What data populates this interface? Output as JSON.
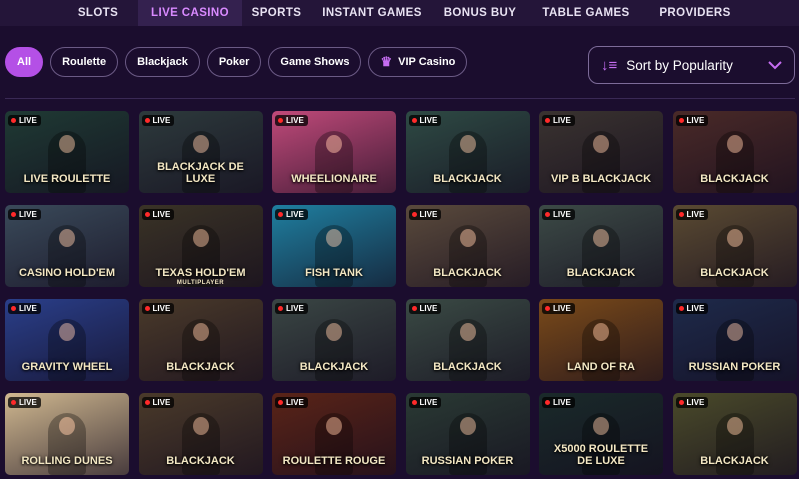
{
  "nav": {
    "items": [
      {
        "label": "SLOTS",
        "active": false
      },
      {
        "label": "LIVE CASINO",
        "active": true
      },
      {
        "label": "SPORTS",
        "active": false
      },
      {
        "label": "INSTANT GAMES",
        "active": false
      },
      {
        "label": "BONUS BUY",
        "active": false
      },
      {
        "label": "TABLE GAMES",
        "active": false
      },
      {
        "label": "PROVIDERS",
        "active": false
      }
    ]
  },
  "filters": {
    "chips": [
      {
        "label": "All",
        "active": true
      },
      {
        "label": "Roulette",
        "active": false
      },
      {
        "label": "Blackjack",
        "active": false
      },
      {
        "label": "Poker",
        "active": false
      },
      {
        "label": "Game Shows",
        "active": false
      },
      {
        "label": "VIP Casino",
        "active": false,
        "icon": "crown-icon"
      }
    ]
  },
  "sort": {
    "label": "Sort by Popularity",
    "icon": "sort-icon",
    "chevron": "chevron-down-icon"
  },
  "live_label": "LIVE",
  "colors": {
    "accent": "#b450e6",
    "background": "#1b0d2e",
    "nav": "#241539",
    "live_dot": "#ff2a2a"
  },
  "tiles": [
    {
      "title": "LIVE ROULETTE",
      "sub": "",
      "bg": "#1f3a34"
    },
    {
      "title": "BLACKJACK DE LUXE",
      "sub": "",
      "bg": "#2d3a3c"
    },
    {
      "title": "WHEELIONAIRE",
      "sub": "",
      "bg": "#c04a7a"
    },
    {
      "title": "BLACKJACK",
      "sub": "",
      "bg": "#2e4a44"
    },
    {
      "title": "VIP B BLACKJACK",
      "sub": "",
      "bg": "#3a3330"
    },
    {
      "title": "BLACKJACK",
      "sub": "",
      "bg": "#4a2a28"
    },
    {
      "title": "CASINO HOLD'EM",
      "sub": "",
      "bg": "#3a4a5a"
    },
    {
      "title": "TEXAS HOLD'EM",
      "sub": "MULTIPLAYER",
      "bg": "#3a3326"
    },
    {
      "title": "FISH TANK",
      "sub": "",
      "bg": "#1f7fa0"
    },
    {
      "title": "BLACKJACK",
      "sub": "",
      "bg": "#5a4a3c"
    },
    {
      "title": "BLACKJACK",
      "sub": "",
      "bg": "#3c4a46"
    },
    {
      "title": "BLACKJACK",
      "sub": "",
      "bg": "#5a4a32"
    },
    {
      "title": "GRAVITY WHEEL",
      "sub": "",
      "bg": "#2a3f8a"
    },
    {
      "title": "BLACKJACK",
      "sub": "",
      "bg": "#4a3a2a"
    },
    {
      "title": "BLACKJACK",
      "sub": "",
      "bg": "#3a4644"
    },
    {
      "title": "BLACKJACK",
      "sub": "",
      "bg": "#3a4a44"
    },
    {
      "title": "LAND OF RA",
      "sub": "",
      "bg": "#7a4a1a"
    },
    {
      "title": "RUSSIAN POKER",
      "sub": "",
      "bg": "#1e2a4a"
    },
    {
      "title": "ROLLING DUNES",
      "sub": "",
      "bg": "#d0b890"
    },
    {
      "title": "BLACKJACK",
      "sub": "",
      "bg": "#4a3a2a"
    },
    {
      "title": "ROULETTE ROUGE",
      "sub": "",
      "bg": "#5a2418"
    },
    {
      "title": "RUSSIAN POKER",
      "sub": "",
      "bg": "#2a3a34"
    },
    {
      "title": "X5000 ROULETTE DE LUXE",
      "sub": "",
      "bg": "#1a2a2a"
    },
    {
      "title": "BLACKJACK",
      "sub": "",
      "bg": "#4a4a2a"
    }
  ]
}
